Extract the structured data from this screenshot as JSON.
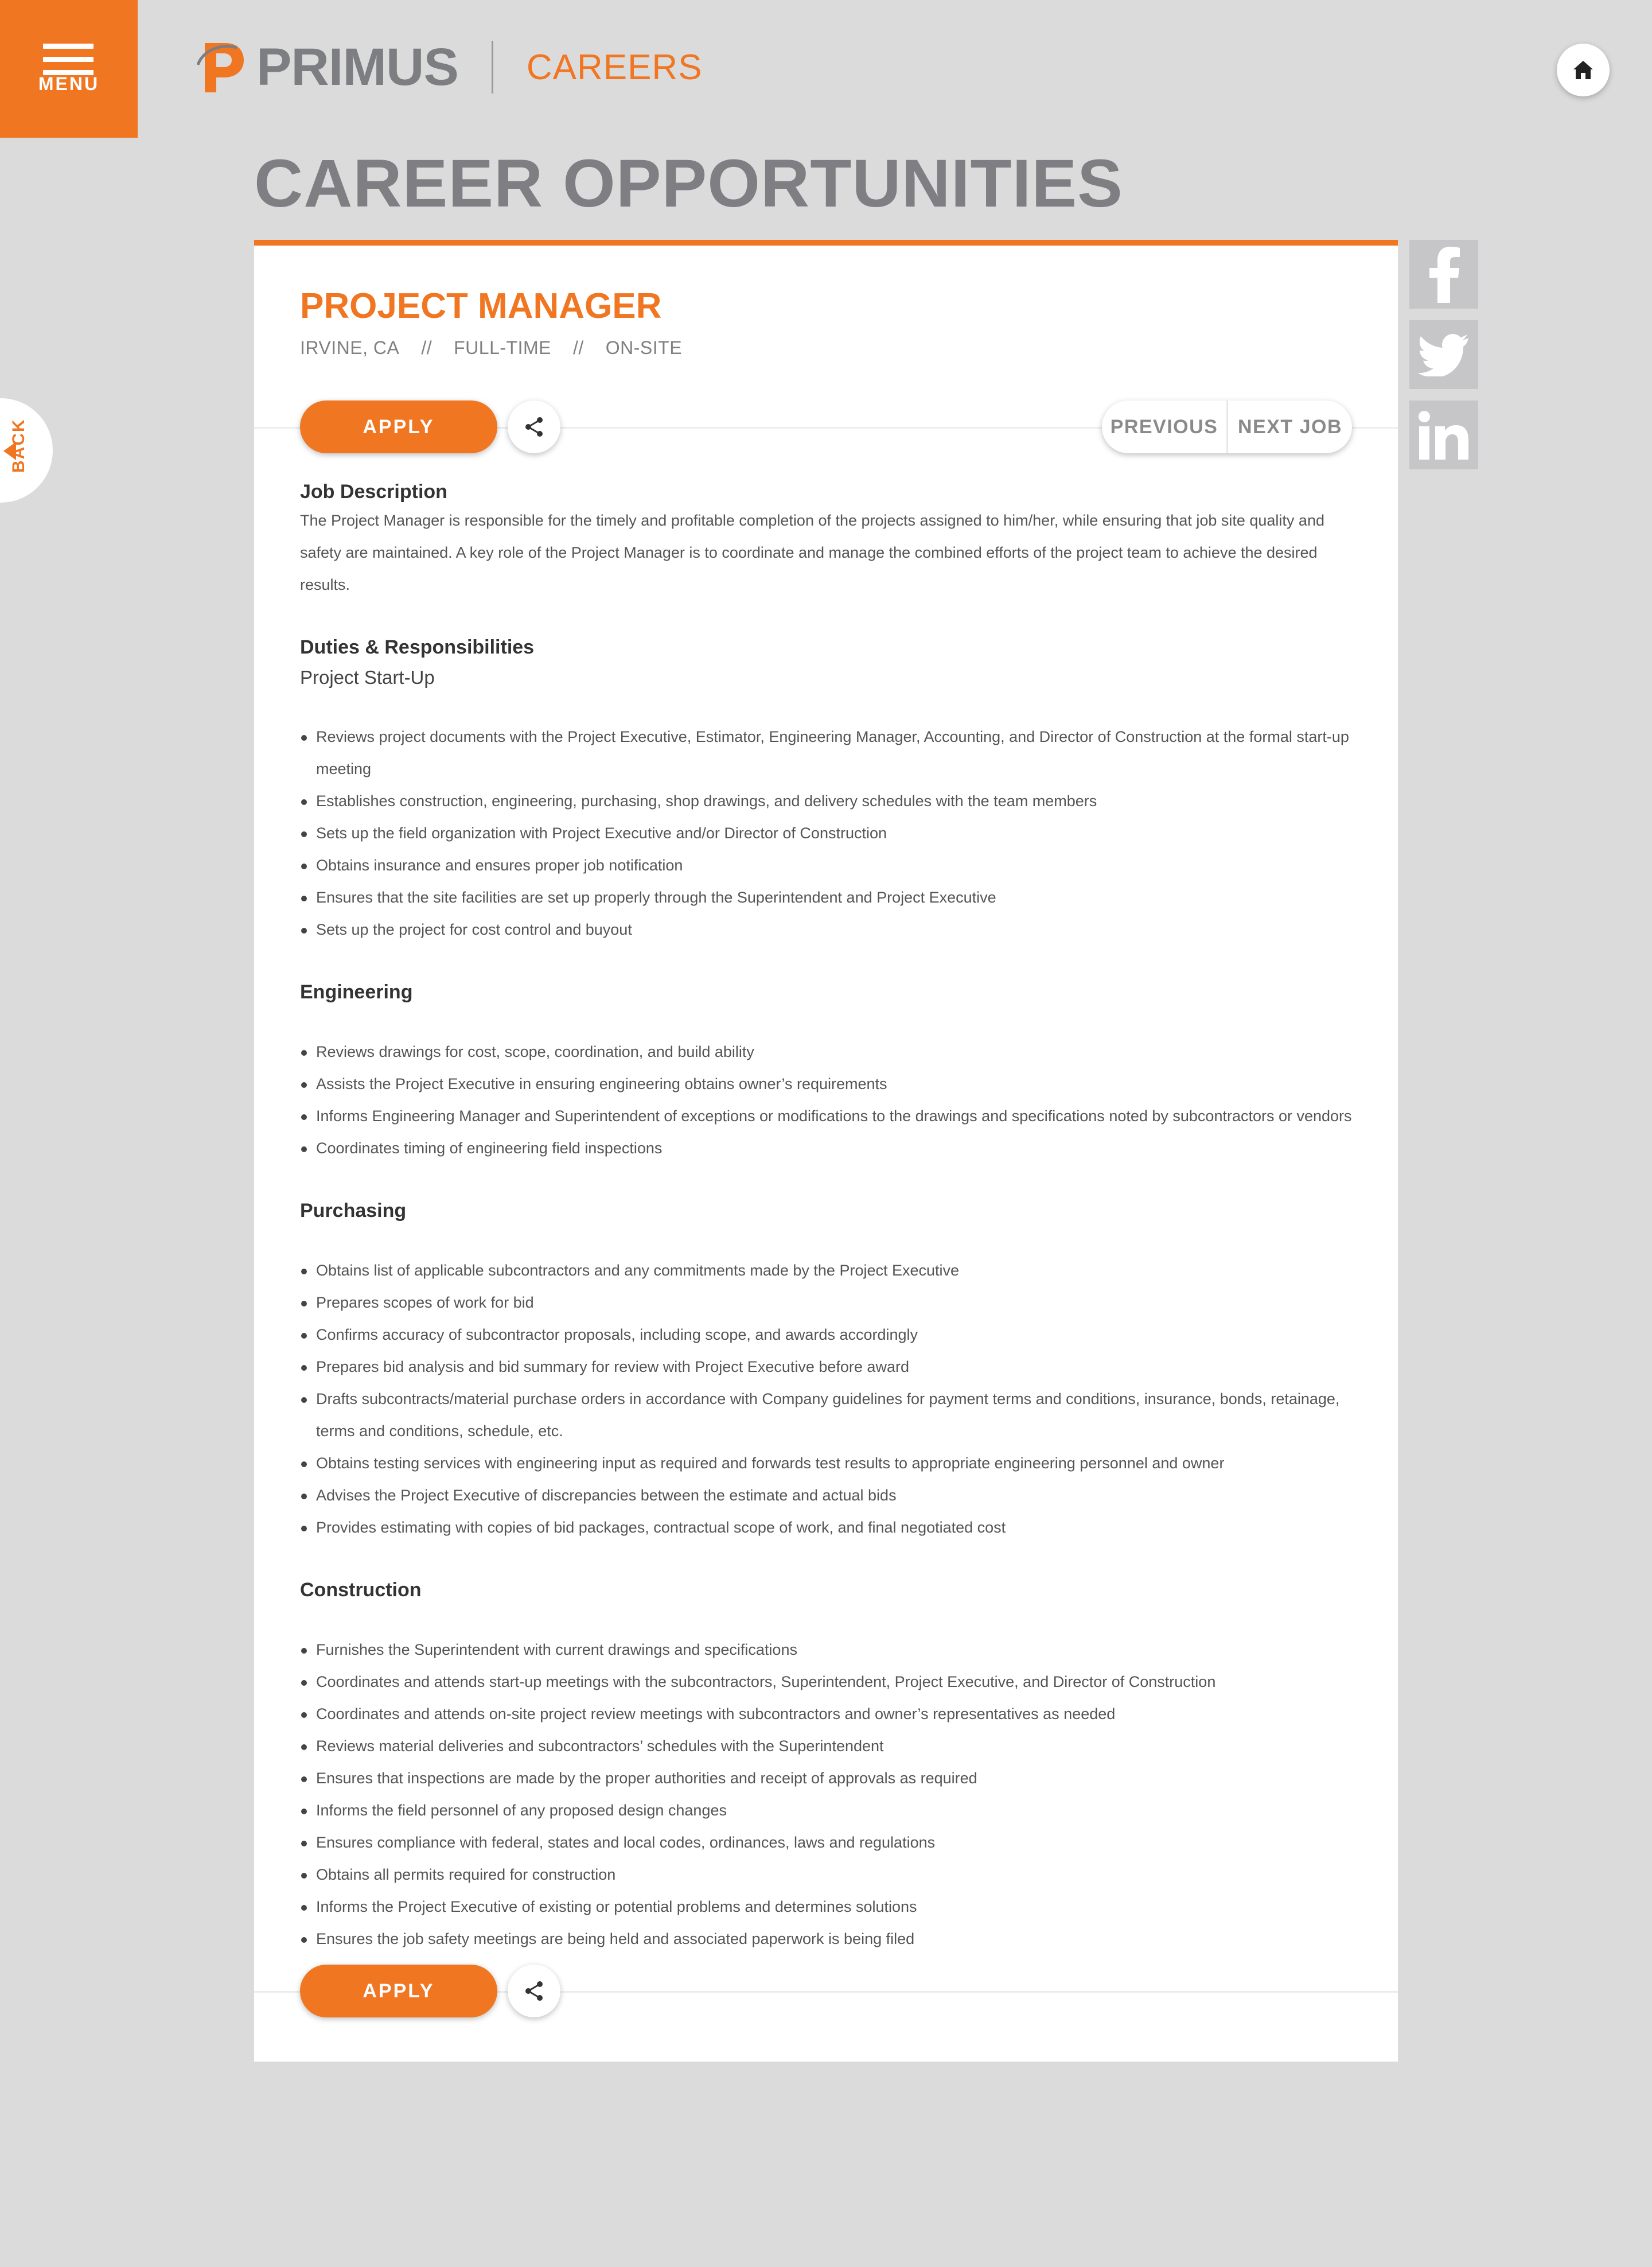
{
  "header": {
    "menu_label": "MENU",
    "brand": "PRIMUS",
    "section": "CAREERS",
    "home_icon": "home-icon"
  },
  "page": {
    "title": "CAREER OPPORTUNITIES",
    "back_label": "BACK"
  },
  "social": [
    "facebook-icon",
    "twitter-icon",
    "linkedin-icon"
  ],
  "job": {
    "title": "PROJECT MANAGER",
    "location": "IRVINE, CA",
    "sep": "//",
    "type": "FULL-TIME",
    "site": "ON-SITE",
    "apply_label": "APPLY",
    "previous_label": "PREVIOUS",
    "next_label": "NEXT JOB"
  },
  "description": {
    "heading": "Job Description",
    "text": "The Project Manager is responsible for the timely and profitable completion of the projects assigned to him/her, while ensuring that job site quality and safety are maintained. A key role of the Project Manager is to coordinate and manage the combined efforts of the project team to achieve the desired results."
  },
  "duties": {
    "heading": "Duties & Responsibilities",
    "startup_heading": "Project Start-Up",
    "startup": [
      "Reviews project documents with the Project Executive, Estimator, Engineering Manager,  Accounting, and Director of Construction at the formal start-up meeting",
      "Establishes construction, engineering, purchasing, shop drawings, and delivery schedules with the team members",
      "Sets up the field organization with Project Executive and/or Director of Construction",
      "Obtains insurance and ensures proper job notification",
      "Ensures that the site facilities are set up properly through the Superintendent and Project Executive",
      "Sets up the project for cost control and buyout"
    ],
    "engineering_heading": "Engineering",
    "engineering": [
      "Reviews drawings for cost, scope, coordination, and build ability",
      "Assists the Project Executive in ensuring engineering obtains owner’s requirements",
      "Informs Engineering Manager and Superintendent of exceptions or modifications to the drawings and specifications noted by subcontractors or vendors",
      "Coordinates timing of engineering field inspections"
    ],
    "purchasing_heading": "Purchasing",
    "purchasing": [
      "Obtains list of applicable subcontractors and any commitments made by the Project Executive",
      "Prepares scopes of work for bid",
      "Confirms accuracy of subcontractor proposals, including scope, and awards accordingly",
      "Prepares bid analysis and bid summary for review with Project Executive before award",
      "Drafts subcontracts/material purchase orders in accordance with Company guidelines for payment terms and conditions, insurance, bonds, retainage, terms and conditions, schedule, etc.",
      "Obtains testing services with engineering input as required and forwards test results to appropriate engineering personnel and owner",
      "Advises the Project Executive of discrepancies between the estimate and actual bids",
      "Provides estimating with copies of bid packages, contractual scope of work, and final negotiated cost"
    ],
    "construction_heading": "Construction",
    "construction": [
      "Furnishes the Superintendent with current drawings and specifications",
      "Coordinates and attends start-up meetings with the subcontractors, Superintendent, Project Executive, and Director of Construction",
      "Coordinates and attends on-site project review meetings with subcontractors and owner’s representatives as needed",
      "Reviews material deliveries and subcontractors’ schedules with the Superintendent",
      "Ensures that inspections are made by the proper authorities and receipt of approvals as required",
      "Informs the field personnel of any proposed design changes",
      "Ensures compliance with federal, states and local codes, ordinances, laws and regulations",
      "Obtains all permits required for construction",
      "Informs the Project Executive of existing or potential problems and determines solutions",
      "Ensures the job safety meetings are being held and associated paperwork is being filed"
    ]
  }
}
